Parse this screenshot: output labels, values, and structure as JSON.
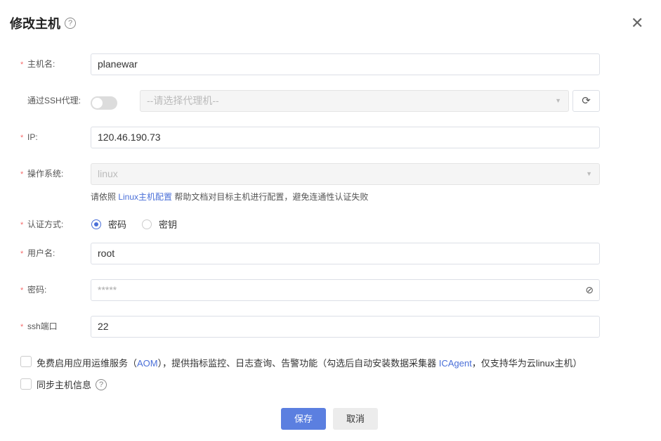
{
  "dialog": {
    "title": "修改主机",
    "close": "✕"
  },
  "fields": {
    "hostname": {
      "label": "主机名:",
      "value": "planewar"
    },
    "ssh_proxy": {
      "label": "通过SSH代理:",
      "placeholder": "--请选择代理机--"
    },
    "ip": {
      "label": "IP:",
      "value": "120.46.190.73"
    },
    "os": {
      "label": "操作系统:",
      "value": "linux"
    },
    "hint": {
      "pre": "请依照 ",
      "link": "Linux主机配置",
      "post": " 帮助文档对目标主机进行配置，避免连通性认证失败"
    },
    "auth": {
      "label": "认证方式:",
      "options": [
        "密码",
        "密钥"
      ],
      "selected": "密码"
    },
    "username": {
      "label": "用户名:",
      "value": "root"
    },
    "password": {
      "label": "密码:",
      "value": "*****"
    },
    "port": {
      "label": "ssh端口",
      "value": "22"
    }
  },
  "aom": {
    "pre": "免费启用应用运维服务（",
    "link1": "AOM",
    "mid": "），提供指标监控、日志查询、告警功能（勾选后自动安装数据采集器 ",
    "link2": "ICAgent",
    "post": "，仅支持华为云linux主机）",
    "checked": false
  },
  "sync": {
    "label": "同步主机信息",
    "checked": false
  },
  "buttons": {
    "save": "保存",
    "cancel": "取消"
  },
  "colors": {
    "primary": "#5b7fe0",
    "required": "#f56c6c"
  }
}
